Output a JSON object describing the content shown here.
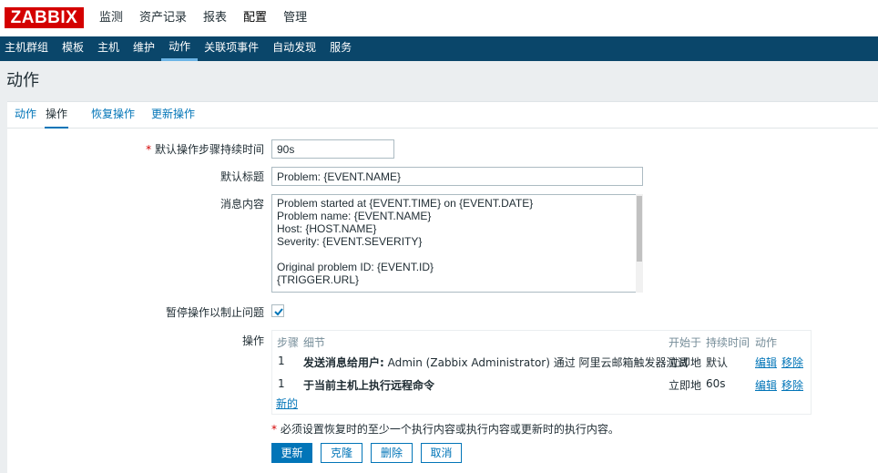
{
  "logo": "ZABBIX",
  "top_menu": [
    "监测",
    "资产记录",
    "报表",
    "配置",
    "管理"
  ],
  "sub_menu": [
    "主机群组",
    "模板",
    "主机",
    "维护",
    "动作",
    "关联项事件",
    "自动发现",
    "服务"
  ],
  "page_title": "动作",
  "tabs": [
    "动作",
    "操作",
    "恢复操作",
    "更新操作"
  ],
  "form": {
    "step_duration_label": "默认操作步骤持续时间",
    "step_duration_required": "*",
    "step_duration_value": "90s",
    "subject_label": "默认标题",
    "subject_value": "Problem: {EVENT.NAME}",
    "message_label": "消息内容",
    "message_value": "Problem started at {EVENT.TIME} on {EVENT.DATE}\nProblem name: {EVENT.NAME}\nHost: {HOST.NAME}\nSeverity: {EVENT.SEVERITY}\n\nOriginal problem ID: {EVENT.ID}\n{TRIGGER.URL}",
    "pause_label": "暂停操作以制止问题",
    "pause_checked": true,
    "operations_label": "操作"
  },
  "operations_table": {
    "headers": [
      "步骤",
      "细节",
      "开始于",
      "持续时间",
      "动作"
    ],
    "rows": [
      {
        "step": "1",
        "detail_bold": "发送消息给用户:",
        "detail_rest": " Admin (Zabbix Administrator) 通过 阿里云邮箱触发器测试",
        "start": "立即地",
        "duration": "默认",
        "edit": "编辑",
        "remove": "移除"
      },
      {
        "step": "1",
        "detail_bold": "于当前主机上执行远程命令",
        "detail_rest": "",
        "start": "立即地",
        "duration": "60s",
        "edit": "编辑",
        "remove": "移除"
      }
    ],
    "new_link": "新的"
  },
  "note_required": "*",
  "note_text": " 必须设置恢复时的至少一个执行内容或执行内容或更新时的执行内容。",
  "buttons": {
    "update": "更新",
    "clone": "克隆",
    "delete": "删除",
    "cancel": "取消"
  },
  "colors": {
    "brand": "#d40000",
    "nav": "#0a466a",
    "link": "#0275b8"
  }
}
